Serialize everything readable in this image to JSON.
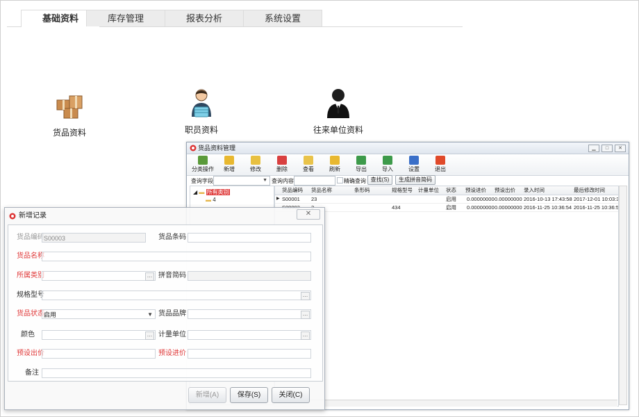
{
  "tabs": [
    "基础资料",
    "库存管理",
    "报表分析",
    "系统设置"
  ],
  "launchers": [
    {
      "label": "货品资料",
      "icon": "boxes-icon"
    },
    {
      "label": "职员资料",
      "icon": "employee-icon"
    },
    {
      "label": "往来单位资料",
      "icon": "contact-person-icon"
    }
  ],
  "goods_window": {
    "title": "货品资料管理",
    "toolbar": [
      "分类操作",
      "新增",
      "修改",
      "删除",
      "查看",
      "刷新",
      "导出",
      "导入",
      "设置",
      "退出"
    ],
    "query": {
      "field_label": "查询字段",
      "content_label": "查询内容",
      "exact_label": "精确查询",
      "find_button": "查找(S)",
      "pinyin_button": "生成拼音简码"
    },
    "tree": {
      "root": "所有类别",
      "child": "4"
    },
    "columns": [
      "货品编码",
      "货品名称",
      "条形码",
      "规格型号",
      "计量单位",
      "状态",
      "预设进价",
      "预设出价",
      "录入时间",
      "最后修改时间"
    ],
    "rows": [
      [
        "S00001",
        "23",
        "",
        "",
        "",
        "启用",
        "0.00000000",
        "0.00000000",
        "2016-10-13 17:43:58",
        "2017-12-01 10:03:36"
      ],
      [
        "S00002",
        "2",
        "",
        "434",
        "",
        "启用",
        "0.00000000",
        "0.00000000",
        "2016-11-25 10:36:54",
        "2016-11-25 10:36:54"
      ]
    ]
  },
  "dialog": {
    "title": "新增记录",
    "fields": {
      "code_label": "货品编码",
      "code_value": "S00003",
      "barcode_label": "货品条码",
      "name_label": "货品名称",
      "category_label": "所属类别",
      "pinyin_label": "拼音简码",
      "spec_label": "规格型号",
      "status_label": "货品状态",
      "status_value": "启用",
      "brand_label": "货品品牌",
      "color_label": "颜色",
      "unit_label": "计量单位",
      "sale_price_label": "预设出价",
      "purchase_price_label": "预设进价",
      "note_label": "备注"
    },
    "buttons": {
      "add": "新增(A)",
      "save": "保存(S)",
      "close": "关闭(C)"
    }
  },
  "colors": {
    "required_label": "#e03a3a",
    "window_border": "#9aa7b6"
  }
}
